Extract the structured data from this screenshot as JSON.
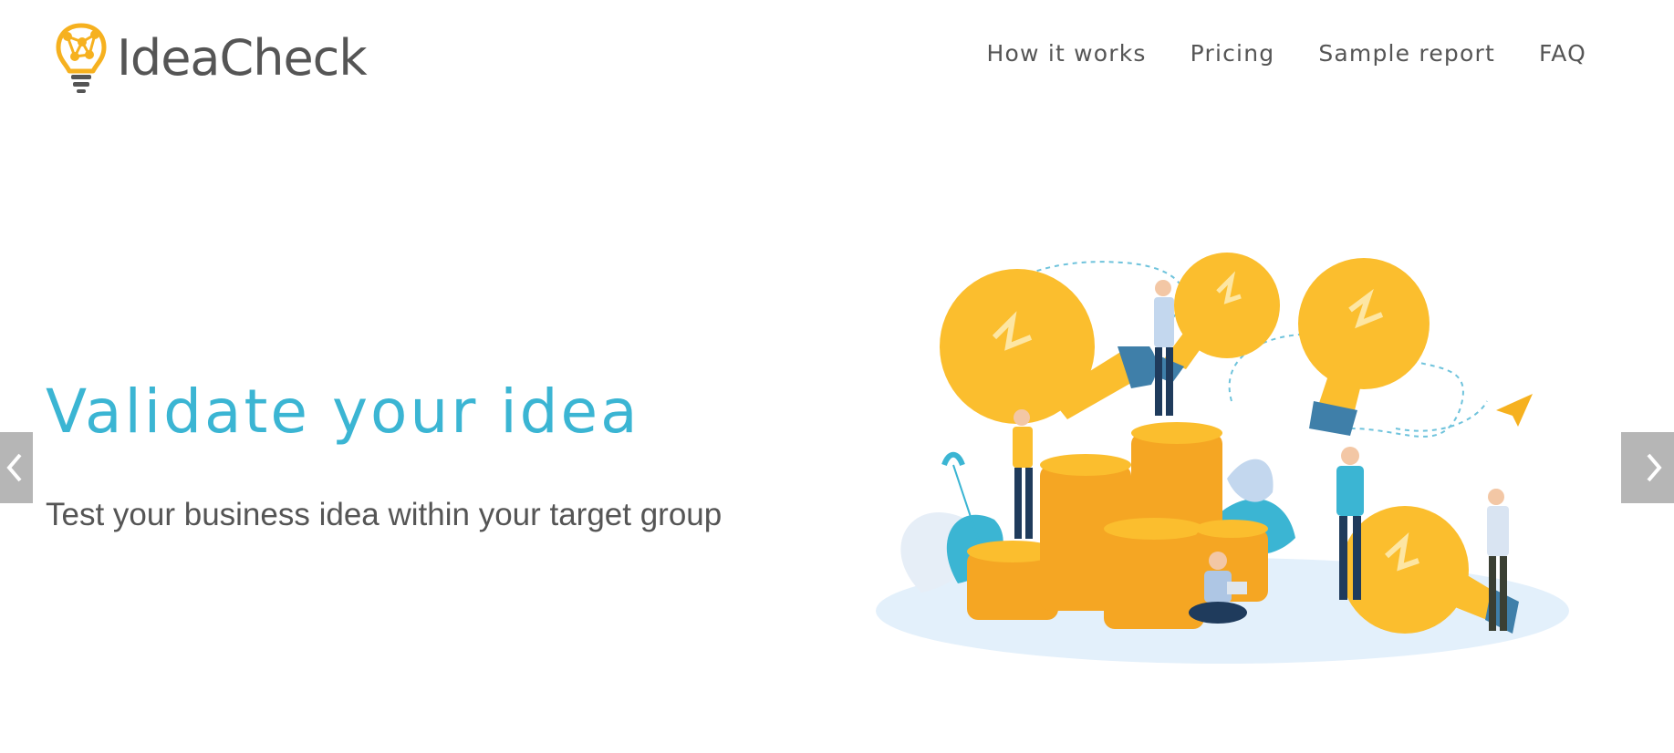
{
  "header": {
    "logo_text": "IdeaCheck",
    "logo_icon": "lightbulb-network-icon",
    "nav": [
      {
        "label": "How it works"
      },
      {
        "label": "Pricing"
      },
      {
        "label": "Sample report"
      },
      {
        "label": "FAQ"
      }
    ]
  },
  "hero": {
    "title": "Validate your idea",
    "subtitle": "Test your business idea within your target group"
  },
  "carousel": {
    "prev_icon": "chevron-left-icon",
    "next_icon": "chevron-right-icon",
    "arrow_color": "#b6b6b6"
  },
  "colors": {
    "accent": "#3bb5d3",
    "text": "#555555",
    "logo_yellow": "#f6b11f",
    "bulb_yellow": "#fbbe2e",
    "coin_orange": "#f5a623"
  }
}
